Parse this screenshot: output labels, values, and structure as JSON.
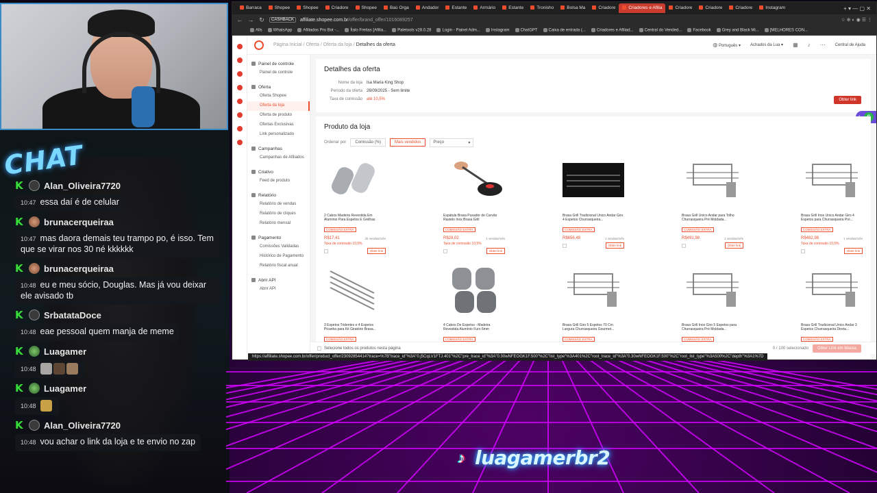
{
  "stream": {
    "chat_logo": "CHAT",
    "tiktok_handle": "luagamerbr2"
  },
  "chat": [
    {
      "user": "Alan_Oliveira7720",
      "avatar": "person",
      "time": "10:47",
      "text": "essa daí é de celular"
    },
    {
      "user": "brunacerqueiraa",
      "avatar": "photo",
      "time": "10:47",
      "text": "mas daora demais teu trampo po, é isso. Tem que se virar nos 30 né kkkkkk"
    },
    {
      "user": "brunacerqueiraa",
      "avatar": "photo",
      "time": "10:48",
      "text": "eu e meu sócio, Douglas. Mas já vou deixar ele avisado tb"
    },
    {
      "user": "SrbatataDoce",
      "avatar": "person",
      "time": "10:48",
      "text": "eae pessoal quem manja de meme"
    },
    {
      "user": "Luagamer",
      "avatar": "game",
      "time": "10:48",
      "text": "",
      "emotes": 4
    },
    {
      "user": "Luagamer",
      "avatar": "game",
      "time": "10:48",
      "text": "",
      "emotes": 1
    },
    {
      "user": "Alan_Oliveira7720",
      "avatar": "person",
      "time": "10:48",
      "text": "vou achar o link da loja e te envio no zap"
    }
  ],
  "browser": {
    "tabs": [
      "Barraca",
      "Shopee",
      "Shopee",
      "Criadore",
      "Shopee",
      "Baú Orga",
      "Andador",
      "Estante",
      "Armário",
      "Estante",
      "Tronisho",
      "Bolsa Ma",
      "Criadore",
      "Criadores e Afilia",
      "Criadore",
      "Criadore",
      "Criadore",
      "Instagram"
    ],
    "active_tab": 13,
    "cashback": "CASHBACK",
    "url_host": "affiliate.shopee.com.br",
    "url_path": "/offer/brand_offer/1016089257",
    "bookmarks": [
      "Alls",
      "WhatsApp",
      "Afiliados Pro Bot -...",
      "Ítalo Freitas [Afilia...",
      "Paletools v28.0.28",
      "Login - Painel Adm...",
      "Instagram",
      "ChatGPT",
      "Caixa de entrada (...",
      "Criadores e Afiliad...",
      "Central do Vended...",
      "Facebook",
      "Grey and Black Mi...",
      "[MELHORES CON..."
    ],
    "status_url": "https://affiliate.shopee.com.br/offer/product_offer/23092854414?trace=%7B\"trace_id\"%3A\"0.j5CqLV1FTJ.401\"%2C\"pre_trace_id\"%3A\"0.30wNFEOGK1F.500\"%2C\"list_type\"%3A401%2C\"root_trace_id\"%3A\"0.30wNFEOGK1F.500\"%2C\"root_list_type\"%3A500%2C\"depth\"%3A1%7D"
  },
  "app": {
    "breadcrumb": [
      "Página Inicial",
      "Oferta",
      "Oferta da loja"
    ],
    "breadcrumb_current": "Detalhes da oferta",
    "header_language": "Português",
    "header_account": "Achados da Lua",
    "header_help": "Central de Ajuda",
    "sidebar": [
      {
        "title": "Painel de controle",
        "items": [
          "Painel de controle"
        ]
      },
      {
        "title": "Oferta",
        "items": [
          "Oferta Shopee",
          "Oferta da loja",
          "Oferta de produto",
          "Ofertas Exclusivas",
          "Link personalizado"
        ],
        "active": "Oferta da loja"
      },
      {
        "title": "Campanhas",
        "items": [
          "Campanhas de Afiliados"
        ]
      },
      {
        "title": "Criativo",
        "items": [
          "Feed de produto"
        ]
      },
      {
        "title": "Relatório",
        "items": [
          "Relatório de vendas",
          "Relatório de cliques",
          "Relatório mensal"
        ]
      },
      {
        "title": "Pagamento",
        "items": [
          "Comissões Validadas",
          "Histórico de Pagamento",
          "Relatório fiscal anual"
        ]
      },
      {
        "title": "Abrir API",
        "items": [
          "Abrir API"
        ]
      }
    ],
    "offer": {
      "title": "Detalhes da oferta",
      "store_label": "Nome da loja",
      "store_value": "Isa Maria King Shop",
      "period_label": "Período da oferta",
      "period_value": "26/09/2025 - Sem limite",
      "commission_label": "Taxa de comissão",
      "commission_value": "até 10,5%",
      "get_link": "Obter link"
    },
    "products": {
      "title": "Produto da loja",
      "sort_label": "Ordenar por",
      "sort_commission": "Comissão (%)",
      "sort_best": "Mais vendidos",
      "sort_price": "Preço",
      "badge": "COMISSÃO EXTRA",
      "link_btn": "Obter link",
      "items": [
        {
          "name": "2 Cabos Madeira Revestida Em Alumínio Para Espetos E Grelhas",
          "price": "R$17,41",
          "sold": "25 vendas/mês",
          "commission": "Taxa de comissão 10,5%",
          "img": "handles"
        },
        {
          "name": "Espátula Brasa Puxador de Carvão Rastelo Inox Brasa Grill",
          "price": "R$28,02",
          "sold": "1 vendas/mês",
          "commission": "Taxa de comissão 10,5%",
          "img": "tool"
        },
        {
          "name": "Brasa Grill Tradicional Único Andar Giro 4 Espetos Churrasqueira...",
          "price": "R$656,48",
          "sold": "1 vendas/mês",
          "commission": "",
          "img": "grill-dark"
        },
        {
          "name": "Brasa Grill Único Andar para Tolho Churrasqueira Pré Moldada...",
          "price": "R$491,98",
          "sold": "1 vendas/mês",
          "commission": "",
          "img": "grill"
        },
        {
          "name": "Brasa Grill Inox Único Andar Giro 4 Espetos para Churrasqueira Pré...",
          "price": "R$482,98",
          "sold": "1 vendas/mês",
          "commission": "Taxa de comissão 10,5%",
          "img": "grill"
        },
        {
          "name": "3 Espetos Tridentes e 4 Espetos Picanha para Kit Giratório Brasa...",
          "price": "",
          "sold": "",
          "commission": "",
          "img": "skewers"
        },
        {
          "name": "4 Cabos De Espetos - Madeira Revestida Alumínio Furo 6mm",
          "price": "",
          "sold": "",
          "commission": "",
          "img": "handles4"
        },
        {
          "name": "Brasa Grill Giro 5 Espetos 70 Cm Largura Churrasqueira Gourmet...",
          "price": "",
          "sold": "",
          "commission": "",
          "img": "grill"
        },
        {
          "name": "Brasa Grill Inox Giro 5 Espetos para Churrasqueira Pré Moldada...",
          "price": "",
          "sold": "",
          "commission": "",
          "img": "grill"
        },
        {
          "name": "Brasa Grill Tradicional Único Andar 3 Espetos Churrasqueira Direta...",
          "price": "",
          "sold": "",
          "commission": "",
          "img": "grill"
        }
      ],
      "select_all": "Selecione todos os produtos nesta página",
      "selected_count": "0 / 100 selecionado",
      "bulk_btn": "Obter Link em Massa"
    }
  },
  "colors": {
    "shopee": "#ee4d2d",
    "chat_badge": "#37e038",
    "neon": "#d400ff"
  }
}
